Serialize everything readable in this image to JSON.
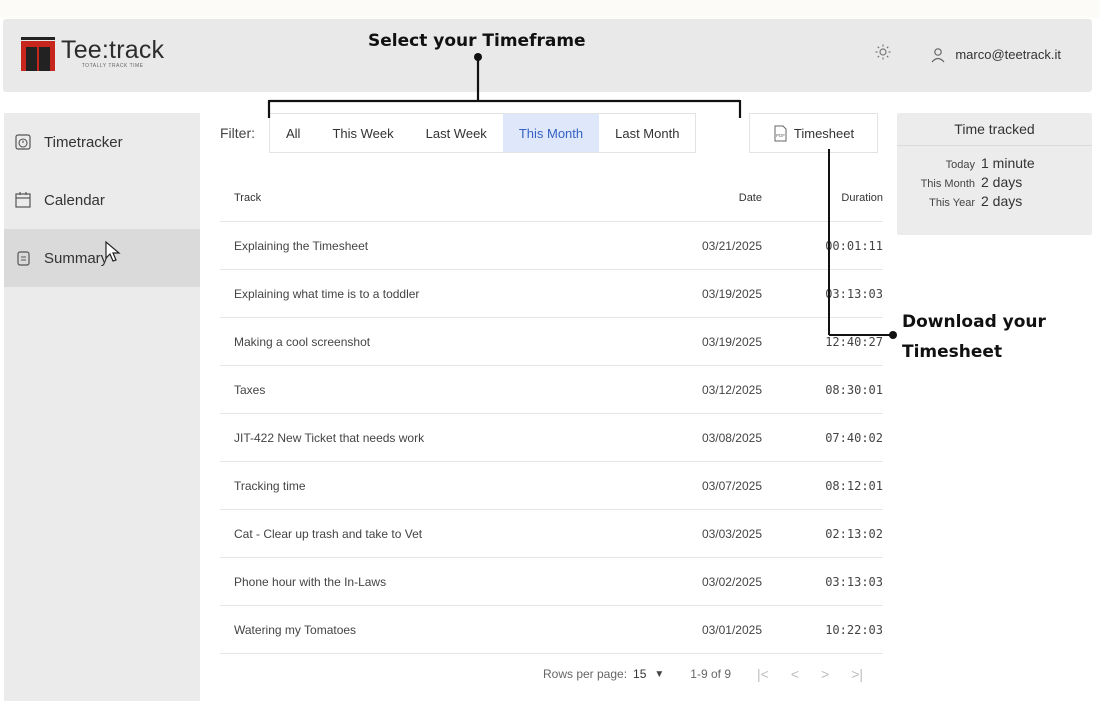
{
  "app": {
    "name": "Tee:track",
    "tagline": "TOTALLY TRACK TIME",
    "user_email": "marco@teetrack.it"
  },
  "icons": {
    "theme": "sun-icon",
    "user": "user-icon",
    "timetracker": "stopwatch-icon",
    "calendar": "calendar-icon",
    "summary": "document-icon",
    "pdf": "pdf-icon"
  },
  "sidebar": {
    "items": [
      {
        "label": "Timetracker"
      },
      {
        "label": "Calendar"
      },
      {
        "label": "Summary",
        "active": true
      }
    ]
  },
  "filter": {
    "label": "Filter:",
    "chips": [
      {
        "label": "All"
      },
      {
        "label": "This Week"
      },
      {
        "label": "Last Week"
      },
      {
        "label": "This Month",
        "selected": true
      },
      {
        "label": "Last Month"
      }
    ],
    "timesheet_button": "Timesheet"
  },
  "table": {
    "headers": {
      "track": "Track",
      "date": "Date",
      "duration": "Duration"
    },
    "rows": [
      {
        "track": "Explaining the Timesheet",
        "date": "03/21/2025",
        "duration": "00:01:11"
      },
      {
        "track": "Explaining what time is to a toddler",
        "date": "03/19/2025",
        "duration": "03:13:03"
      },
      {
        "track": "Making a cool screenshot",
        "date": "03/19/2025",
        "duration": "12:40:27"
      },
      {
        "track": "Taxes",
        "date": "03/12/2025",
        "duration": "08:30:01"
      },
      {
        "track": "JIT-422 New Ticket that needs work",
        "date": "03/08/2025",
        "duration": "07:40:02"
      },
      {
        "track": "Tracking time",
        "date": "03/07/2025",
        "duration": "08:12:01"
      },
      {
        "track": "Cat - Clear up trash and take to Vet",
        "date": "03/03/2025",
        "duration": "02:13:02"
      },
      {
        "track": "Phone hour with the In-Laws",
        "date": "03/02/2025",
        "duration": "03:13:03"
      },
      {
        "track": "Watering my Tomatoes",
        "date": "03/01/2025",
        "duration": "10:22:03"
      }
    ]
  },
  "pagination": {
    "rows_label": "Rows per page:",
    "rows_value": "15",
    "range": "1-9 of 9",
    "first": "|<",
    "prev": "<",
    "next": ">",
    "last": ">|"
  },
  "time_tracked": {
    "title": "Time tracked",
    "rows": [
      {
        "label": "Today",
        "value": "1 minute"
      },
      {
        "label": "This Month",
        "value": "2 days"
      },
      {
        "label": "This Year",
        "value": "2 days"
      }
    ]
  },
  "annotations": {
    "timeframe": "Select your Timeframe",
    "download_line1": "Download your",
    "download_line2": "Timesheet"
  }
}
